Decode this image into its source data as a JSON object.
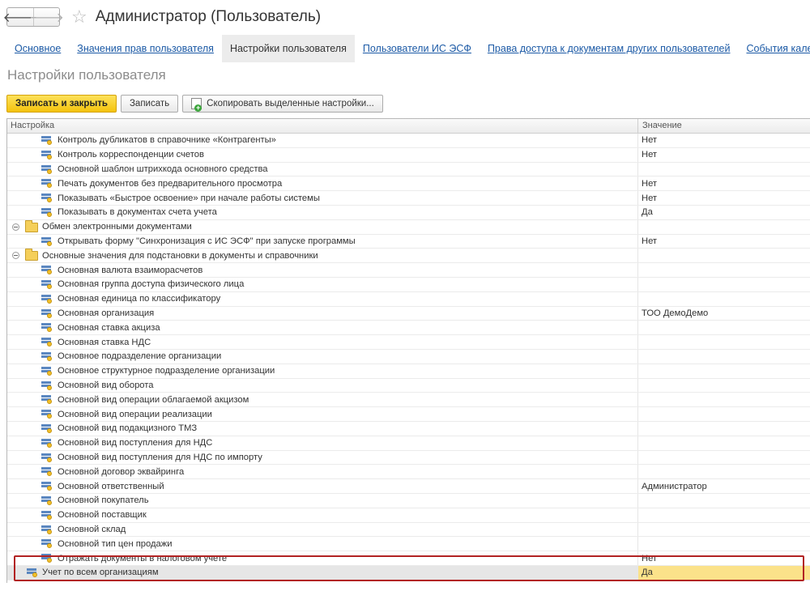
{
  "window": {
    "title": "Администратор (Пользователь)"
  },
  "nav": {
    "back": "🡐",
    "forward": "🡒",
    "favorite": "☆"
  },
  "tabs": [
    {
      "label": "Основное"
    },
    {
      "label": "Значения прав пользователя"
    },
    {
      "label": "Настройки пользователя"
    },
    {
      "label": "Пользователи ИС ЭСФ"
    },
    {
      "label": "Права доступа к документам других пользователей"
    },
    {
      "label": "События календаря"
    }
  ],
  "page": {
    "title": "Настройки пользователя"
  },
  "toolbar": {
    "save_close": "Записать и закрыть",
    "save": "Записать",
    "copy": "Скопировать выделенные настройки..."
  },
  "grid": {
    "col_setting": "Настройка",
    "col_value": "Значение",
    "rows": [
      {
        "name": "Контроль дубликатов в справочнике «Контрагенты»",
        "value": "Нет"
      },
      {
        "name": "Контроль корреспонденции счетов",
        "value": "Нет"
      },
      {
        "name": "Основной шаблон штрихкода основного средства",
        "value": ""
      },
      {
        "name": "Печать документов без предварительного просмотра",
        "value": "Нет"
      },
      {
        "name": "Показывать «Быстрое освоение» при начале работы системы",
        "value": "Нет"
      },
      {
        "name": "Показывать в документах счета учета",
        "value": "Да"
      },
      {
        "name": "Обмен электронными документами",
        "value": ""
      },
      {
        "name": "Открывать форму \"Синхронизация с ИС ЭСФ\" при запуске программы",
        "value": "Нет"
      },
      {
        "name": "Основные значения для подстановки в документы и справочники",
        "value": ""
      },
      {
        "name": "Основная валюта взаиморасчетов",
        "value": ""
      },
      {
        "name": "Основная группа доступа физического лица",
        "value": ""
      },
      {
        "name": "Основная единица по классификатору",
        "value": ""
      },
      {
        "name": "Основная организация",
        "value": "ТОО ДемоДемо"
      },
      {
        "name": "Основная ставка акциза",
        "value": ""
      },
      {
        "name": "Основная ставка НДС",
        "value": ""
      },
      {
        "name": "Основное подразделение организации",
        "value": ""
      },
      {
        "name": "Основное структурное подразделение организации",
        "value": ""
      },
      {
        "name": "Основной вид оборота",
        "value": ""
      },
      {
        "name": "Основной вид операции облагаемой акцизом",
        "value": ""
      },
      {
        "name": "Основной вид операции реализации",
        "value": ""
      },
      {
        "name": "Основной вид подакцизного ТМЗ",
        "value": ""
      },
      {
        "name": "Основной вид поступления для НДС",
        "value": ""
      },
      {
        "name": "Основной вид поступления для НДС по импорту",
        "value": ""
      },
      {
        "name": "Основной договор эквайринга",
        "value": ""
      },
      {
        "name": "Основной ответственный",
        "value": "Администратор"
      },
      {
        "name": "Основной покупатель",
        "value": ""
      },
      {
        "name": "Основной поставщик",
        "value": ""
      },
      {
        "name": "Основной склад",
        "value": ""
      },
      {
        "name": "Основной тип цен продажи",
        "value": ""
      },
      {
        "name": "Отражать документы в налоговом учете",
        "value": "Нет"
      },
      {
        "name": "Учет по всем организациям",
        "value": "Да"
      }
    ]
  }
}
